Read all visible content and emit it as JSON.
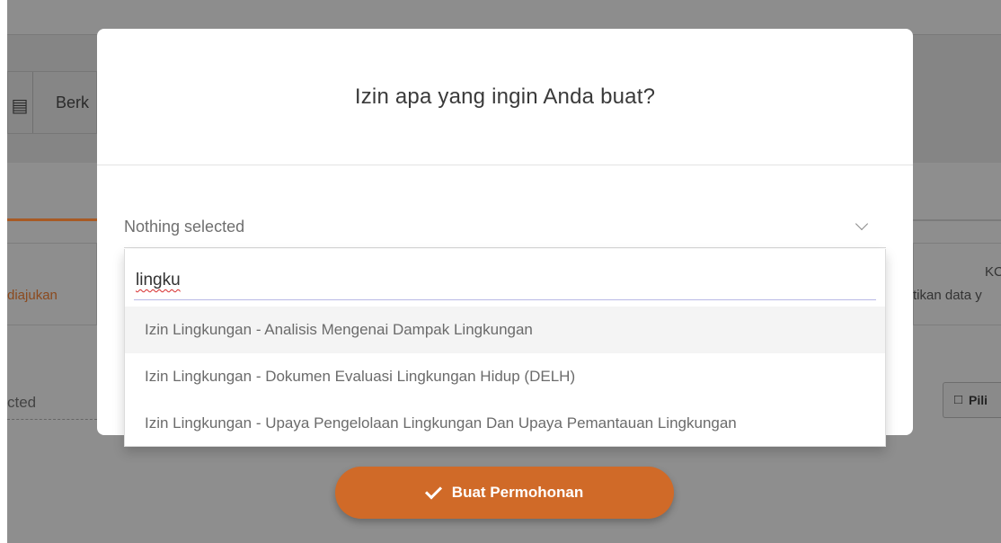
{
  "background": {
    "tab_label": "Berk",
    "status_left": "diajukan",
    "status_right_title": "KC",
    "status_right_sub": "tikan data y",
    "select_partial": "cted",
    "file_button_label": "Pili",
    "accent_color": "#d06a28"
  },
  "modal": {
    "title": "Izin apa yang ingin Anda buat?",
    "select": {
      "value": "Nothing selected"
    },
    "search": {
      "value": "lingku"
    },
    "options": [
      {
        "label": "Izin Lingkungan - Analisis Mengenai Dampak Lingkungan"
      },
      {
        "label": "Izin Lingkungan - Dokumen Evaluasi Lingkungan Hidup (DELH)"
      },
      {
        "label": "Izin Lingkungan - Upaya Pengelolaan Lingkungan Dan Upaya Pemantauan Lingkungan"
      }
    ]
  },
  "actions": {
    "submit_label": "Buat Permohonan",
    "submit_icon": "check-icon"
  }
}
